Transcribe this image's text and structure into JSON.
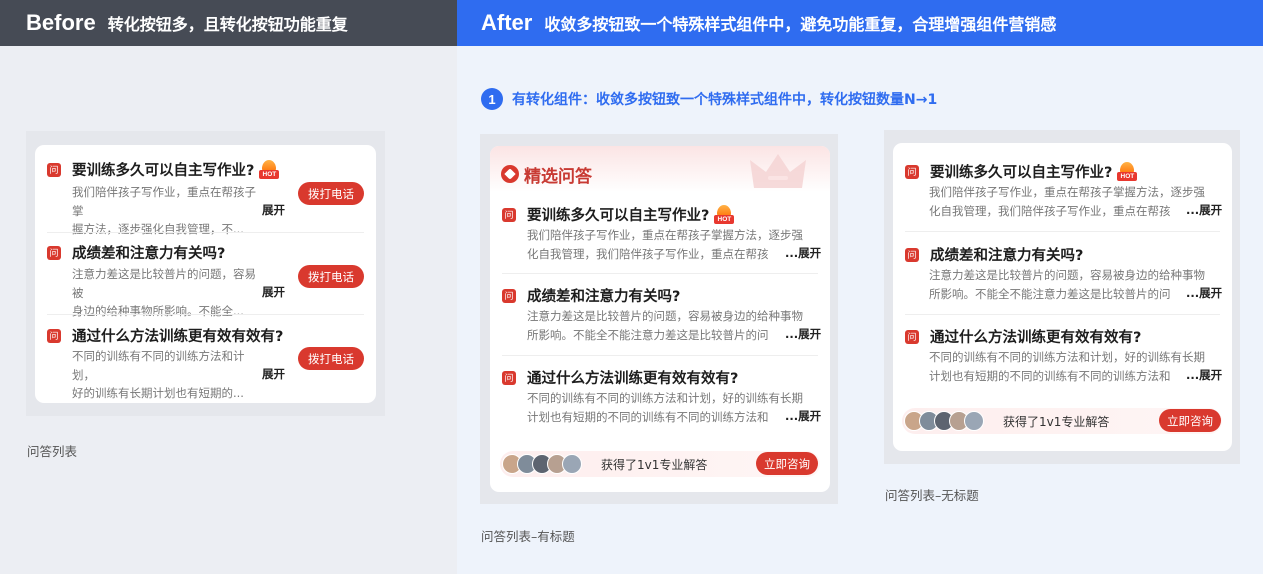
{
  "before": {
    "label": "Before",
    "text": "转化按钮多，且转化按钮功能重复",
    "caption": "问答列表",
    "call_label": "拨打电话",
    "more_label": "展开",
    "items": [
      {
        "badge": "问",
        "title": "要训练多久可以自主写作业?",
        "hot": "HOT",
        "line1": "我们陪伴孩子写作业，重点在帮孩子掌",
        "line2": "握方法，逐步强化自我管理，不..."
      },
      {
        "badge": "问",
        "title": "成绩差和注意力有关吗?",
        "line1": "注意力差这是比较普片的问题，容易被",
        "line2": "身边的给种事物所影响。不能全..."
      },
      {
        "badge": "问",
        "title": "通过什么方法训练更有效有效有?",
        "line1": "不同的训练有不同的训练方法和计划，",
        "line2": "好的训练有长期计划也有短期的..."
      }
    ]
  },
  "after": {
    "label": "After",
    "text": "收敛多按钮致一个特殊样式组件中，避免功能重复，合理增强组件营销感",
    "step_number": "1",
    "step_text": "有转化组件：收敛多按钮致一个特殊样式组件中，转化按钮数量N→1",
    "featured_title": "精选问答",
    "caption_with_title": "问答列表–有标题",
    "caption_no_title": "问答列表–无标题",
    "consult_text": "获得了1v1专业解答",
    "consult_btn": "立即咨询",
    "more_label": "...展开",
    "items_titled": [
      {
        "badge": "问",
        "title": "要训练多久可以自主写作业?",
        "hot": "HOT",
        "line1": "我们陪伴孩子写作业，重点在帮孩子掌握方法，逐步强",
        "line2": "化自我管理，我们陪伴孩子写作业，重点在帮孩"
      },
      {
        "badge": "问",
        "title": "成绩差和注意力有关吗?",
        "line1": "注意力差这是比较普片的问题，容易被身边的给种事物",
        "line2": "所影响。不能全不能注意力差这是比较普片的问"
      },
      {
        "badge": "问",
        "title": "通过什么方法训练更有效有效有?",
        "line1": "不同的训练有不同的训练方法和计划，好的训练有长期",
        "line2": "计划也有短期的不同的训练有不同的训练方法和"
      }
    ],
    "items_plain": [
      {
        "badge": "问",
        "title": "要训练多久可以自主写作业?",
        "hot": "HOT",
        "line1": "我们陪伴孩子写作业，重点在帮孩子掌握方法，逐步强",
        "line2": "化自我管理，我们陪伴孩子写作业，重点在帮孩"
      },
      {
        "badge": "问",
        "title": "成绩差和注意力有关吗?",
        "line1": "注意力差这是比较普片的问题，容易被身边的给种事物",
        "line2": "所影响。不能全不能注意力差这是比较普片的问"
      },
      {
        "badge": "问",
        "title": "通过什么方法训练更有效有效有?",
        "line1": "不同的训练有不同的训练方法和计划，好的训练有长期",
        "line2": "计划也有短期的不同的训练有不同的训练方法和"
      }
    ]
  },
  "colors": {
    "accent_red": "#d9392e",
    "blue": "#2f6cf0",
    "dark_bar": "#464b55"
  }
}
